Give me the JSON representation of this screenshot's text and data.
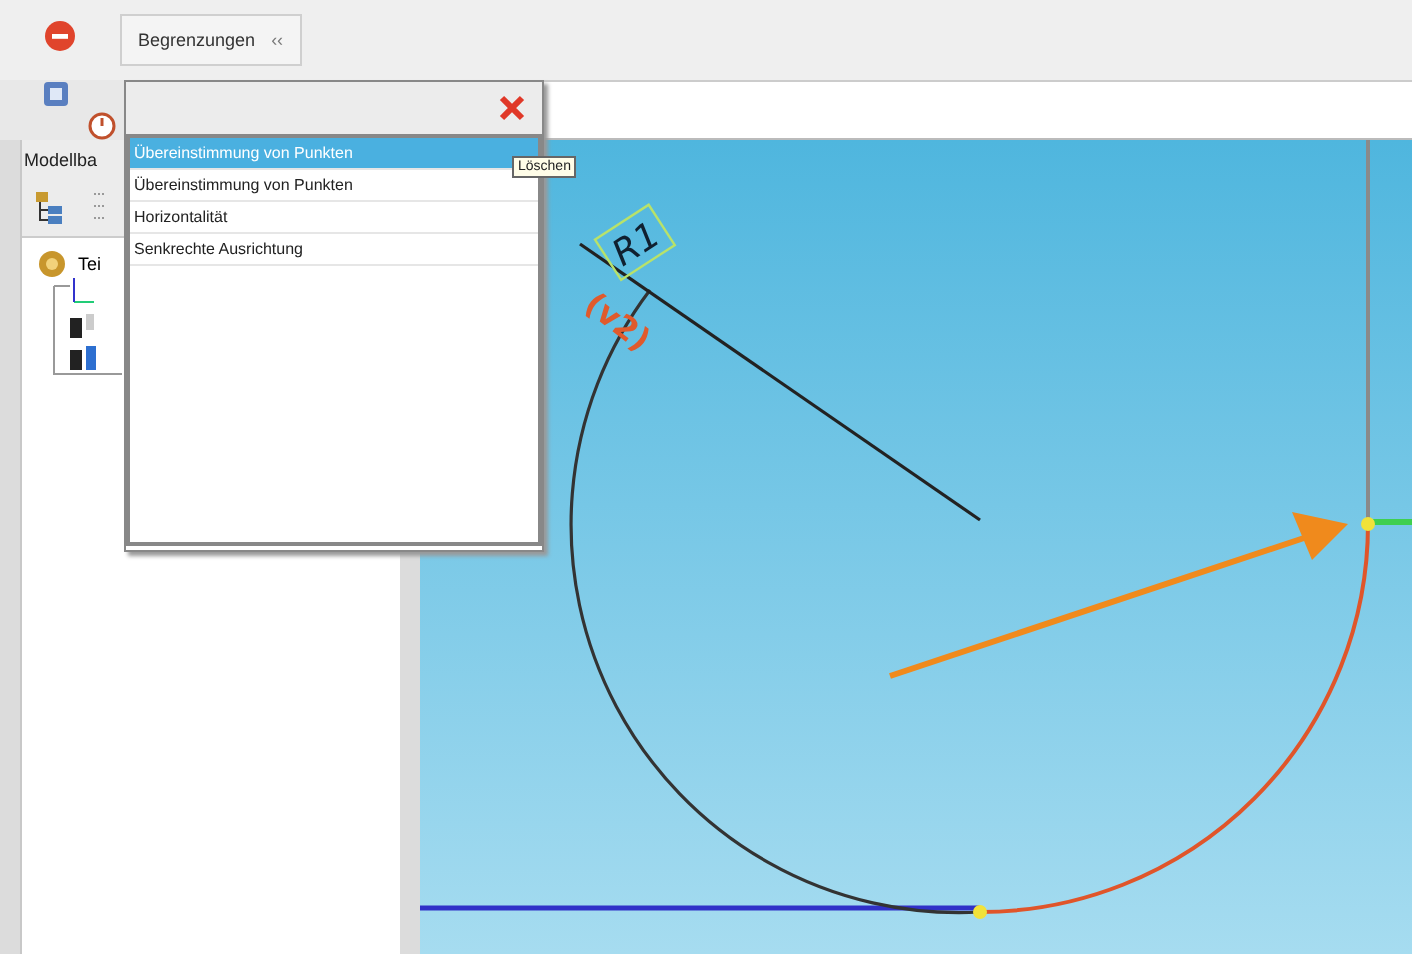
{
  "tab": {
    "label": "Begrenzungen",
    "collapse": "‹‹"
  },
  "sidebar": {
    "title": "Modellba",
    "tree_root": "Tei"
  },
  "popup": {
    "items": [
      {
        "label": "Übereinstimmung von Punkten",
        "selected": true
      },
      {
        "label": "Übereinstimmung von Punkten",
        "selected": false
      },
      {
        "label": "Horizontalität",
        "selected": false
      },
      {
        "label": "Senkrechte Ausrichtung",
        "selected": false
      }
    ],
    "tooltip": "Löschen"
  },
  "sketch": {
    "dimension": "R1",
    "label": "(v2)"
  }
}
